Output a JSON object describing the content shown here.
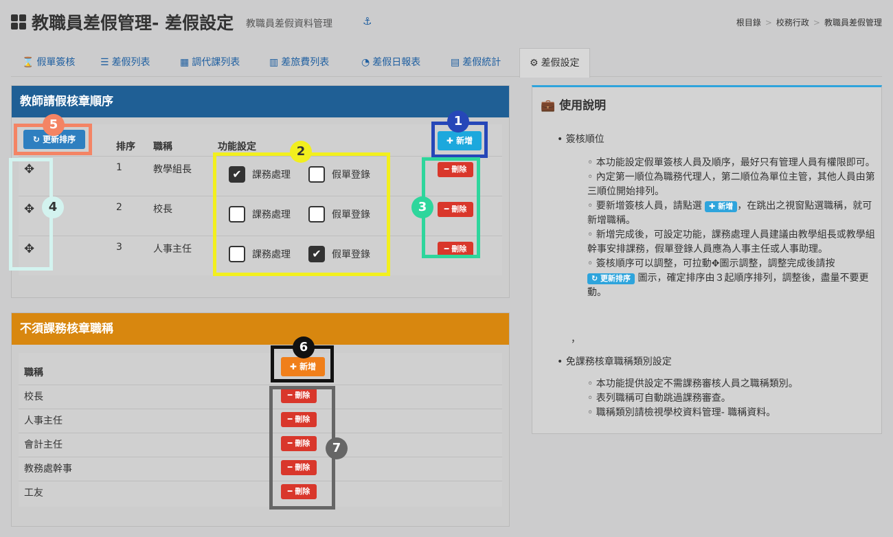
{
  "header": {
    "title": "教職員差假管理- 差假設定",
    "subtitle": "教職員差假資料管理",
    "breadcrumb": [
      "根目錄",
      "校務行政",
      "教職員差假管理"
    ]
  },
  "tabs": [
    {
      "label": "假單簽核",
      "icon": "hourglass-icon"
    },
    {
      "label": "差假列表",
      "icon": "list-icon"
    },
    {
      "label": "調代課列表",
      "icon": "table-icon"
    },
    {
      "label": "差旅費列表",
      "icon": "bar-chart-icon"
    },
    {
      "label": "差假日報表",
      "icon": "pie-chart-icon"
    },
    {
      "label": "差假統計",
      "icon": "calculator-icon"
    },
    {
      "label": "差假設定",
      "icon": "gears-icon",
      "active": true
    }
  ],
  "approval_panel": {
    "title": "教師請假核章順序",
    "refresh_label": "更新排序",
    "add_label": "新增",
    "columns": {
      "order": "排序",
      "title": "職稱",
      "function": "功能設定"
    },
    "option_a": "課務處理",
    "option_b": "假單登錄",
    "delete_label": "刪除",
    "rows": [
      {
        "order": "1",
        "title": "教學組長",
        "course": true,
        "leave": false
      },
      {
        "order": "2",
        "title": "校長",
        "course": false,
        "leave": false
      },
      {
        "order": "3",
        "title": "人事主任",
        "course": false,
        "leave": true
      }
    ]
  },
  "exempt_panel": {
    "title": "不須課務核章職稱",
    "column": "職稱",
    "add_label": "新增",
    "delete_label": "刪除",
    "rows": [
      "校長",
      "人事主任",
      "會計主任",
      "教務處幹事",
      "工友"
    ]
  },
  "help": {
    "title": "使用說明",
    "section1": "簽核順位",
    "s1_items": [
      "本功能設定假單簽核人員及順序，最好只有管理人員有權限即可。",
      "內定第一順位為職務代理人，第二順位為單位主管，其他人員由第三順位開始排列。",
      "要新增簽核人員，請點選",
      "，在跳出之視窗點選職稱，就可新增職稱。",
      "新增完成後，可設定功能，課務處理人員建議由教學組長或教學組幹事安排課務，假單登錄人員應為人事主任或人事助理。",
      "簽核順序可以調整，可拉動",
      "圖示調整，調整完成後請按",
      "圖示，確定排序由３起順序排列，調整後，盡量不要更動。"
    ],
    "inline_add": "新增",
    "inline_refresh": "更新排序",
    "comma": "，",
    "section2": "免課務核章職稱類別設定",
    "s2_items": [
      "本功能提供設定不需課務審核人員之職稱類別。",
      "表列職稱可自動跳過課務審查。",
      "職稱類別請檢視學校資料管理- 職稱資料。"
    ]
  },
  "markers": [
    "1",
    "2",
    "3",
    "4",
    "5",
    "6",
    "7"
  ],
  "colors": {
    "blue_header": "#1f5f95",
    "orange_header": "#d8870f",
    "accent": "#2ea4dc"
  }
}
